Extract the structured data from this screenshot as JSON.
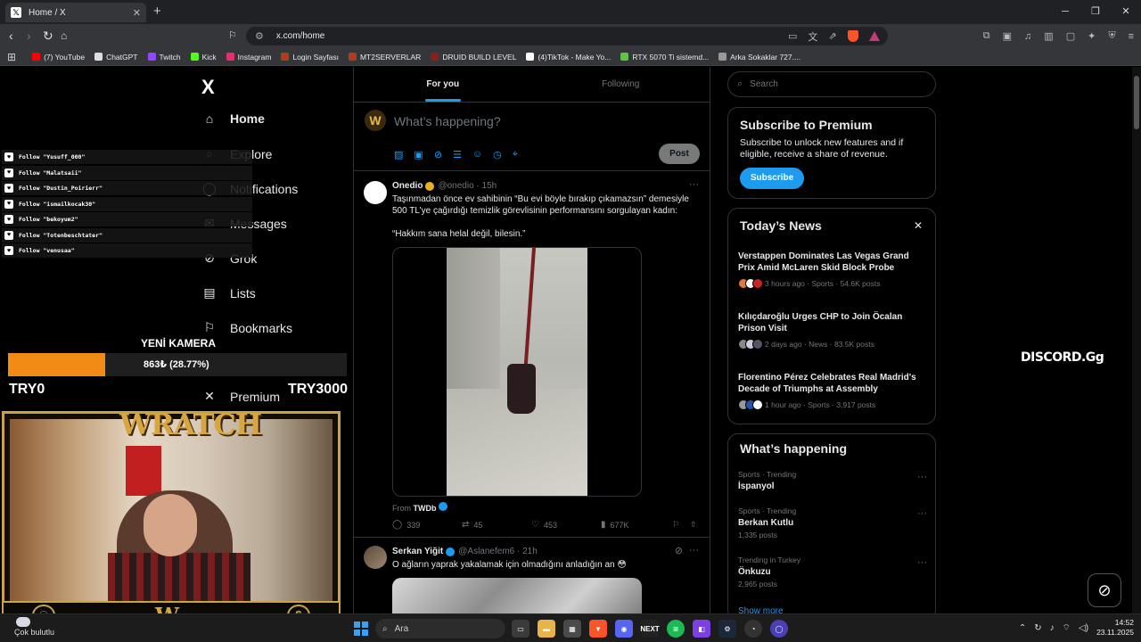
{
  "browser": {
    "tab_title": "Home / X",
    "url": "x.com/home",
    "bookmarks": [
      {
        "label": "(7) YouTube",
        "color": "#ff0000"
      },
      {
        "label": "ChatGPT",
        "color": "#dddddd"
      },
      {
        "label": "Twitch",
        "color": "#9146ff"
      },
      {
        "label": "Kick",
        "color": "#53fc18"
      },
      {
        "label": "Instagram",
        "color": "#e1306c"
      },
      {
        "label": "Login Sayfası",
        "color": "#b23b1b"
      },
      {
        "label": "MT2SERVERLAR",
        "color": "#b23b1b"
      },
      {
        "label": "DRUID BUILD LEVEL",
        "color": "#8b1f1f"
      },
      {
        "label": "(4)TikTok - Make Yo...",
        "color": "#ffffff"
      },
      {
        "label": "RTX 5070 Ti sistemd...",
        "color": "#5ec34a"
      },
      {
        "label": "Arka Sokaklar 727....",
        "color": "#999999"
      }
    ]
  },
  "nav": {
    "logo": "X",
    "items": [
      {
        "label": "Home",
        "icon": "home-icon",
        "glyph": "⌂"
      },
      {
        "label": "Explore",
        "icon": "search-icon",
        "glyph": "⌕"
      },
      {
        "label": "Notifications",
        "icon": "bell-icon",
        "glyph": "◯"
      },
      {
        "label": "Messages",
        "icon": "mail-icon",
        "glyph": "✉"
      },
      {
        "label": "Grok",
        "icon": "grok-icon",
        "glyph": "⊘"
      },
      {
        "label": "Lists",
        "icon": "list-icon",
        "glyph": "▤"
      },
      {
        "label": "Bookmarks",
        "icon": "bookmark-icon",
        "glyph": "⚐"
      },
      {
        "label": "Premium",
        "icon": "x-premium-icon",
        "glyph": "✕"
      }
    ]
  },
  "timeline": {
    "tabs": [
      "For you",
      "Following"
    ],
    "composer_placeholder": "What’s happening?",
    "post_label": "Post",
    "tweets": [
      {
        "name": "Onedio",
        "handle": "@onedio",
        "time": "15h",
        "text1": "Taşınmadan önce ev sahibinin “Bu evi böyle bırakıp çıkamazsın” demesiyle 500 TL’ye çağırdığı temizlik görevlisinin performansını sorgulayan kadın:",
        "text2": "“Hakkım sana helal değil, bilesin.”",
        "from_prefix": "From",
        "from": "TWDb",
        "replies": "339",
        "reposts": "45",
        "likes": "453",
        "views": "677K"
      },
      {
        "name": "Serkan Yiğit",
        "handle": "@Aslanefem6",
        "time": "21h",
        "text1": "O ağların yaprak yakalamak için olmadığını anladığın an 😳"
      }
    ]
  },
  "right": {
    "search_placeholder": "Search",
    "premium": {
      "title": "Subscribe to Premium",
      "text": "Subscribe to unlock new features and if eligible, receive a share of revenue.",
      "button": "Subscribe"
    },
    "news": {
      "title": "Today’s News",
      "items": [
        {
          "title": "Verstappen Dominates Las Vegas Grand Prix Amid McLaren Skid Block Probe",
          "meta": "3 hours ago · Sports · 54.6K posts"
        },
        {
          "title": "Kılıçdaroğlu Urges CHP to Join Öcalan Prison Visit",
          "meta": "2 days ago · News · 83.5K posts"
        },
        {
          "title": "Florentino Pérez Celebrates Real Madrid's Decade of Triumphs at Assembly",
          "meta": "1 hour ago · Sports · 3,917 posts"
        }
      ]
    },
    "happening": {
      "title": "What’s happening",
      "trends": [
        {
          "context": "Sports · Trending",
          "name": "İspanyol",
          "posts": ""
        },
        {
          "context": "Sports · Trending",
          "name": "Berkan Kutlu",
          "posts": "1,335 posts"
        },
        {
          "context": "Trending in Turkey",
          "name": "Önkuzu",
          "posts": "2,965 posts"
        }
      ],
      "show_more": "Show more"
    }
  },
  "overlay": {
    "follows": [
      "Follow \"Yusuff_000\"",
      "Follow \"Malatsaii\"",
      "Follow \"Dustin_Poirierr\"",
      "Follow \"ismailkocak30\"",
      "Follow \"bekoyum2\"",
      "Follow \"Totenbeschtater\"",
      "Follow \"venusaa\""
    ],
    "goal": {
      "title": "YENİ KAMERA",
      "progress_text": "863₺ (28.77%)",
      "progress_fraction": 0.2877,
      "min": "TRY0",
      "max": "TRY3000"
    },
    "brand": "WRATCH",
    "discord": "DISCORD.Gg"
  },
  "taskbar": {
    "weather": "Çok bulutlu",
    "search": "Ara",
    "time": "14:52",
    "date": "23.11.2025"
  }
}
